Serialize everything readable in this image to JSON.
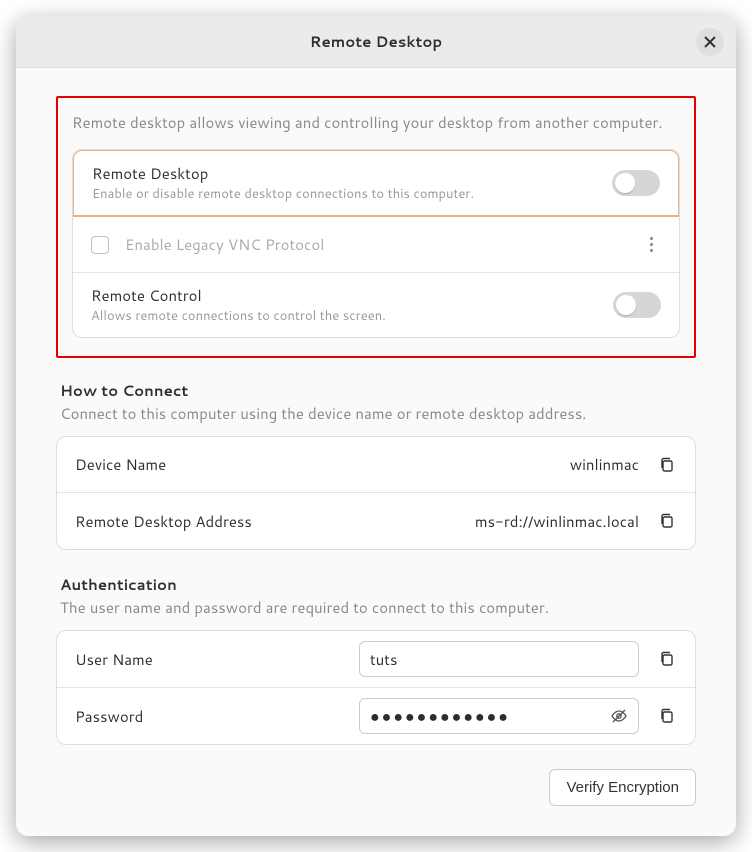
{
  "title": "Remote Desktop",
  "intro": "Remote desktop allows viewing and controlling your desktop from another computer.",
  "main": {
    "remote_desktop": {
      "title": "Remote Desktop",
      "sub": "Enable or disable remote desktop connections to this computer.",
      "enabled": false
    },
    "legacy_vnc": {
      "label": "Enable Legacy VNC Protocol",
      "checked": false
    },
    "remote_control": {
      "title": "Remote Control",
      "sub": "Allows remote connections to control the screen.",
      "enabled": false
    }
  },
  "connect": {
    "title": "How to Connect",
    "sub": "Connect to this computer using the device name or remote desktop address.",
    "device_name_label": "Device Name",
    "device_name_value": "winlinmac",
    "address_label": "Remote Desktop Address",
    "address_value": "ms-rd://winlinmac.local"
  },
  "auth": {
    "title": "Authentication",
    "sub": "The user name and password are required to connect to this computer.",
    "username_label": "User Name",
    "username_value": "tuts",
    "password_label": "Password",
    "password_mask": "●●●●●●●●●●●●"
  },
  "verify_label": "Verify Encryption"
}
